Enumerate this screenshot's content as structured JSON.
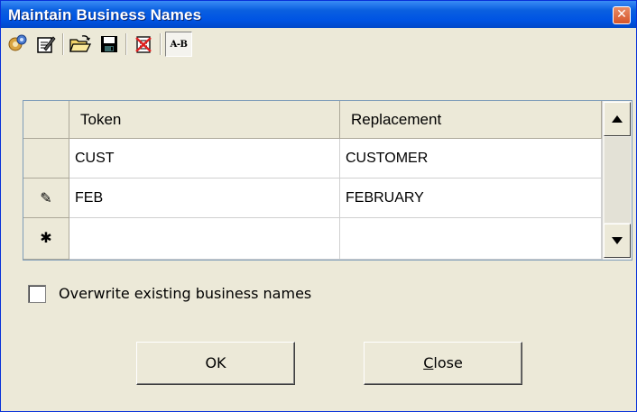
{
  "window": {
    "title": "Maintain Business Names",
    "close_glyph": "✕"
  },
  "toolbar": {
    "items": [
      {
        "name": "settings-icon",
        "tooltip": ""
      },
      {
        "name": "edit-icon"
      },
      {
        "name": "open-folder-icon"
      },
      {
        "name": "save-icon"
      },
      {
        "name": "delete-icon"
      },
      {
        "name": "a-b-toggle",
        "label": "A-B"
      }
    ]
  },
  "grid": {
    "columns": [
      "Token",
      "Replacement"
    ],
    "rows": [
      {
        "indicator": "",
        "token": "CUST",
        "replacement": "CUSTOMER"
      },
      {
        "indicator": "✎",
        "token": "FEB",
        "replacement": "FEBRUARY"
      },
      {
        "indicator": "✱",
        "token": "",
        "replacement": ""
      }
    ]
  },
  "options": {
    "overwrite_label": "Overwrite existing business names",
    "overwrite_checked": false
  },
  "buttons": {
    "ok_label": "OK",
    "close_mnemonic": "C",
    "close_rest": "lose"
  },
  "colors": {
    "titlebar": "#0054e3",
    "face": "#ece9d8",
    "grid_border": "#7f9db9"
  }
}
